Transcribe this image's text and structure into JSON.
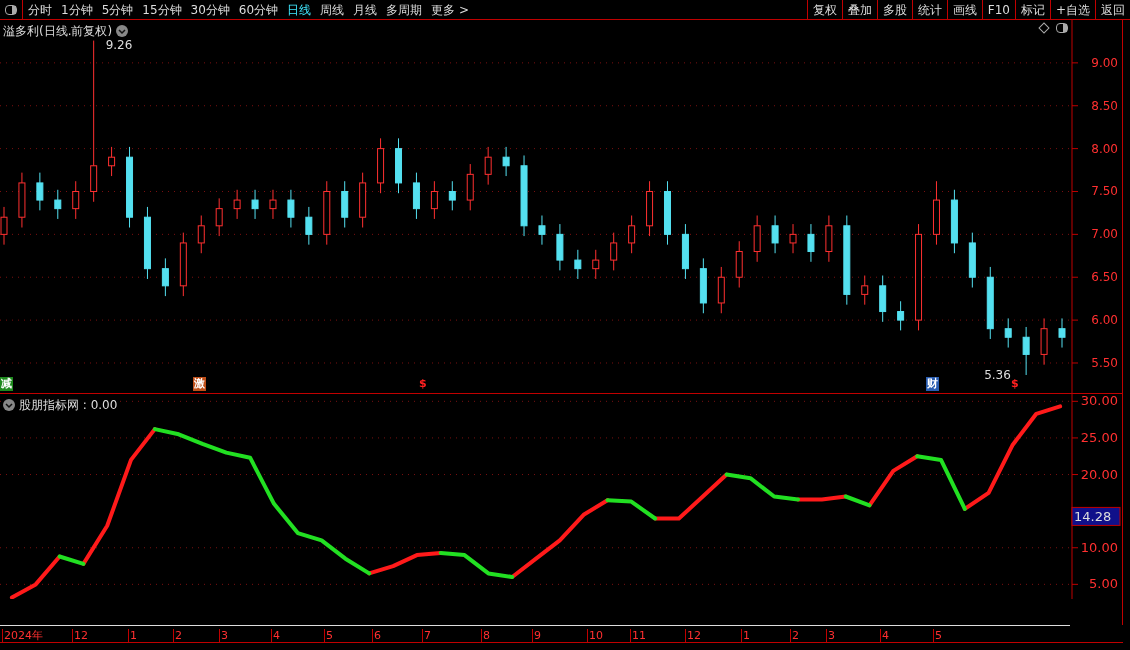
{
  "toolbar": {
    "periods": [
      {
        "label": "分时",
        "selected": false
      },
      {
        "label": "1分钟",
        "selected": false
      },
      {
        "label": "5分钟",
        "selected": false
      },
      {
        "label": "15分钟",
        "selected": false
      },
      {
        "label": "30分钟",
        "selected": false
      },
      {
        "label": "60分钟",
        "selected": false
      },
      {
        "label": "日线",
        "selected": true
      },
      {
        "label": "周线",
        "selected": false
      },
      {
        "label": "月线",
        "selected": false
      },
      {
        "label": "多周期",
        "selected": false
      },
      {
        "label": "更多 >",
        "selected": false
      }
    ],
    "actions": [
      "复权",
      "叠加",
      "多股",
      "统计",
      "画线",
      "F10",
      "标记",
      "+自选",
      "返回"
    ]
  },
  "price_panel": {
    "title": "溢多利(日线.前复权)",
    "high_label": "9.26",
    "low_label": "5.36",
    "markers": [
      {
        "kind": "tag",
        "text": "减",
        "color": "#1e8a1e"
      },
      {
        "kind": "tag",
        "text": "激",
        "color": "#c0501a"
      },
      {
        "kind": "dollar",
        "text": "$",
        "color": "#ff2020"
      },
      {
        "kind": "tag",
        "text": "财",
        "color": "#2a5db0"
      },
      {
        "kind": "dollar",
        "text": "$",
        "color": "#ff2020"
      }
    ],
    "chart_data": {
      "type": "candlestick",
      "grid": true,
      "ylim": [
        5.15,
        9.5
      ],
      "yticks": [
        {
          "value": 9,
          "label": "9.00"
        },
        {
          "value": 8.5,
          "label": "8.50"
        },
        {
          "value": 8,
          "label": "8.00"
        },
        {
          "value": 7.5,
          "label": "7.50"
        },
        {
          "value": 7,
          "label": "7.00"
        },
        {
          "value": 6.5,
          "label": "6.50"
        },
        {
          "value": 6,
          "label": "6.00"
        },
        {
          "value": 5.5,
          "label": "5.50"
        }
      ],
      "ohlc": [
        [
          7.0,
          7.32,
          6.88,
          7.2
        ],
        [
          7.2,
          7.72,
          7.08,
          7.6
        ],
        [
          7.6,
          7.72,
          7.28,
          7.4
        ],
        [
          7.4,
          7.52,
          7.18,
          7.3
        ],
        [
          7.3,
          7.62,
          7.18,
          7.5
        ],
        [
          7.5,
          9.26,
          7.38,
          7.8
        ],
        [
          7.8,
          8.02,
          7.68,
          7.9
        ],
        [
          7.9,
          8.02,
          7.08,
          7.2
        ],
        [
          7.2,
          7.32,
          6.48,
          6.6
        ],
        [
          6.6,
          6.72,
          6.28,
          6.4
        ],
        [
          6.4,
          7.02,
          6.28,
          6.9
        ],
        [
          6.9,
          7.22,
          6.78,
          7.1
        ],
        [
          7.1,
          7.42,
          6.98,
          7.3
        ],
        [
          7.3,
          7.52,
          7.18,
          7.4
        ],
        [
          7.4,
          7.52,
          7.18,
          7.3
        ],
        [
          7.3,
          7.52,
          7.18,
          7.4
        ],
        [
          7.4,
          7.52,
          7.08,
          7.2
        ],
        [
          7.2,
          7.32,
          6.88,
          7.0
        ],
        [
          7.0,
          7.62,
          6.88,
          7.5
        ],
        [
          7.5,
          7.62,
          7.08,
          7.2
        ],
        [
          7.2,
          7.72,
          7.08,
          7.6
        ],
        [
          7.6,
          8.12,
          7.48,
          8.0
        ],
        [
          8.0,
          8.12,
          7.48,
          7.6
        ],
        [
          7.6,
          7.72,
          7.18,
          7.3
        ],
        [
          7.3,
          7.62,
          7.18,
          7.5
        ],
        [
          7.5,
          7.62,
          7.28,
          7.4
        ],
        [
          7.4,
          7.82,
          7.28,
          7.7
        ],
        [
          7.7,
          8.02,
          7.58,
          7.9
        ],
        [
          7.9,
          8.02,
          7.68,
          7.8
        ],
        [
          7.8,
          7.92,
          6.98,
          7.1
        ],
        [
          7.1,
          7.22,
          6.88,
          7.0
        ],
        [
          7.0,
          7.12,
          6.58,
          6.7
        ],
        [
          6.7,
          6.82,
          6.48,
          6.6
        ],
        [
          6.6,
          6.82,
          6.48,
          6.7
        ],
        [
          6.7,
          7.02,
          6.58,
          6.9
        ],
        [
          6.9,
          7.22,
          6.78,
          7.1
        ],
        [
          7.1,
          7.62,
          6.98,
          7.5
        ],
        [
          7.5,
          7.62,
          6.88,
          7.0
        ],
        [
          7.0,
          7.12,
          6.48,
          6.6
        ],
        [
          6.6,
          6.72,
          6.08,
          6.2
        ],
        [
          6.2,
          6.62,
          6.08,
          6.5
        ],
        [
          6.5,
          6.92,
          6.38,
          6.8
        ],
        [
          6.8,
          7.22,
          6.68,
          7.1
        ],
        [
          7.1,
          7.22,
          6.78,
          6.9
        ],
        [
          6.9,
          7.12,
          6.78,
          7.0
        ],
        [
          7.0,
          7.12,
          6.68,
          6.8
        ],
        [
          6.8,
          7.22,
          6.68,
          7.1
        ],
        [
          7.1,
          7.22,
          6.18,
          6.3
        ],
        [
          6.3,
          6.52,
          6.18,
          6.4
        ],
        [
          6.4,
          6.52,
          5.98,
          6.1
        ],
        [
          6.1,
          6.22,
          5.88,
          6.0
        ],
        [
          6.0,
          7.12,
          5.88,
          7.0
        ],
        [
          7.0,
          7.62,
          6.88,
          7.4
        ],
        [
          7.4,
          7.52,
          6.78,
          6.9
        ],
        [
          6.9,
          7.02,
          6.38,
          6.5
        ],
        [
          6.5,
          6.62,
          5.78,
          5.9
        ],
        [
          5.9,
          6.02,
          5.68,
          5.8
        ],
        [
          5.8,
          5.92,
          5.36,
          5.6
        ],
        [
          5.6,
          6.02,
          5.48,
          5.9
        ],
        [
          5.9,
          6.02,
          5.68,
          5.8
        ]
      ]
    }
  },
  "indicator_panel": {
    "title": "股朋指标网 : 0.00",
    "current_value": "14.28",
    "chart_data": {
      "type": "line",
      "grid": true,
      "ylim": [
        3,
        31
      ],
      "yticks": [
        {
          "value": 30,
          "label": "30.00"
        },
        {
          "value": 25,
          "label": "25.00"
        },
        {
          "value": 20,
          "label": "20.00"
        },
        {
          "value": 10,
          "label": "10.00"
        },
        {
          "value": 5,
          "label": "5.00"
        }
      ],
      "series": [
        {
          "color": "#ff1a1a",
          "values": [
            3.2,
            5,
            8.8,
            null,
            null,
            null,
            null,
            null,
            null,
            null,
            null,
            null,
            null,
            null,
            null,
            null,
            null,
            null,
            null,
            null,
            null,
            null,
            null,
            null,
            null,
            null,
            null,
            null,
            null,
            null,
            null,
            null,
            null,
            null,
            null,
            null,
            null,
            null,
            null,
            null,
            null,
            null,
            null,
            null,
            null
          ]
        },
        {
          "color": "#ff1a1a",
          "values": [
            null,
            null,
            null,
            7.8,
            13,
            22,
            26.2,
            null,
            null,
            null,
            null,
            null,
            null,
            null,
            null,
            null,
            null,
            null,
            null,
            null,
            null,
            null,
            null,
            null,
            null,
            null,
            null,
            null,
            null,
            null,
            null,
            null,
            null,
            null,
            null,
            null,
            null,
            null,
            null,
            null,
            null,
            null,
            null,
            null,
            null
          ]
        },
        {
          "color": "#ff1a1a",
          "values": [
            null,
            null,
            null,
            null,
            null,
            null,
            null,
            null,
            null,
            null,
            null,
            null,
            null,
            null,
            null,
            6.5,
            7.5,
            9,
            9.3,
            null,
            null,
            null,
            null,
            null,
            null,
            null,
            null,
            null,
            null,
            null,
            null,
            null,
            null,
            null,
            null,
            null,
            null,
            null,
            null,
            null,
            null,
            null,
            null,
            null,
            null
          ]
        },
        {
          "color": "#ff1a1a",
          "values": [
            null,
            null,
            null,
            null,
            null,
            null,
            null,
            null,
            null,
            null,
            null,
            null,
            null,
            null,
            null,
            null,
            null,
            null,
            null,
            null,
            null,
            6,
            8.5,
            11,
            14.5,
            16.5,
            null,
            null,
            null,
            null,
            null,
            null,
            null,
            null,
            null,
            null,
            null,
            null,
            null,
            null,
            null,
            null,
            null,
            null,
            null
          ]
        },
        {
          "color": "#ff1a1a",
          "values": [
            null,
            null,
            null,
            null,
            null,
            null,
            null,
            null,
            null,
            null,
            null,
            null,
            null,
            null,
            null,
            null,
            null,
            null,
            null,
            null,
            null,
            null,
            null,
            null,
            null,
            null,
            null,
            14,
            14,
            17,
            20,
            null,
            null,
            null,
            null,
            null,
            null,
            null,
            null,
            null,
            null,
            null,
            null,
            null,
            null
          ]
        },
        {
          "color": "#ff1a1a",
          "values": [
            null,
            null,
            null,
            null,
            null,
            null,
            null,
            null,
            null,
            null,
            null,
            null,
            null,
            null,
            null,
            null,
            null,
            null,
            null,
            null,
            null,
            null,
            null,
            null,
            null,
            null,
            null,
            null,
            null,
            null,
            null,
            null,
            null,
            16.6,
            16.6,
            17,
            null,
            null,
            null,
            null,
            null,
            null,
            null,
            null,
            null
          ]
        },
        {
          "color": "#ff1a1a",
          "values": [
            null,
            null,
            null,
            null,
            null,
            null,
            null,
            null,
            null,
            null,
            null,
            null,
            null,
            null,
            null,
            null,
            null,
            null,
            null,
            null,
            null,
            null,
            null,
            null,
            null,
            null,
            null,
            null,
            null,
            null,
            null,
            null,
            null,
            null,
            null,
            null,
            15.8,
            20.5,
            22.5,
            null,
            null,
            null,
            null,
            null,
            null
          ]
        },
        {
          "color": "#ff1a1a",
          "values": [
            null,
            null,
            null,
            null,
            null,
            null,
            null,
            null,
            null,
            null,
            null,
            null,
            null,
            null,
            null,
            null,
            null,
            null,
            null,
            null,
            null,
            null,
            null,
            null,
            null,
            null,
            null,
            null,
            null,
            null,
            null,
            null,
            null,
            null,
            null,
            null,
            null,
            null,
            null,
            null,
            15.3,
            17.5,
            24,
            28.3,
            29.3
          ]
        },
        {
          "color": "#22e022",
          "values": [
            null,
            null,
            8.8,
            7.8,
            null,
            null,
            null,
            null,
            null,
            null,
            null,
            null,
            null,
            null,
            null,
            null,
            null,
            null,
            null,
            null,
            null,
            null,
            null,
            null,
            null,
            null,
            null,
            null,
            null,
            null,
            null,
            null,
            null,
            null,
            null,
            null,
            null,
            null,
            null,
            null,
            null,
            null,
            null,
            null,
            null
          ]
        },
        {
          "color": "#22e022",
          "values": [
            null,
            null,
            null,
            null,
            null,
            null,
            26.2,
            25.5,
            24.2,
            23,
            22.3,
            16,
            12,
            11,
            8.5,
            6.5,
            null,
            null,
            null,
            null,
            null,
            null,
            null,
            null,
            null,
            null,
            null,
            null,
            null,
            null,
            null,
            null,
            null,
            null,
            null,
            null,
            null,
            null,
            null,
            null,
            null,
            null,
            null,
            null,
            null
          ]
        },
        {
          "color": "#22e022",
          "values": [
            null,
            null,
            null,
            null,
            null,
            null,
            null,
            null,
            null,
            null,
            null,
            null,
            null,
            null,
            null,
            null,
            null,
            null,
            9.3,
            9,
            6.5,
            6,
            null,
            null,
            null,
            null,
            null,
            null,
            null,
            null,
            null,
            null,
            null,
            null,
            null,
            null,
            null,
            null,
            null,
            null,
            null,
            null,
            null,
            null,
            null
          ]
        },
        {
          "color": "#22e022",
          "values": [
            null,
            null,
            null,
            null,
            null,
            null,
            null,
            null,
            null,
            null,
            null,
            null,
            null,
            null,
            null,
            null,
            null,
            null,
            null,
            null,
            null,
            null,
            null,
            null,
            null,
            16.5,
            16.3,
            14,
            null,
            null,
            null,
            null,
            null,
            null,
            null,
            null,
            null,
            null,
            null,
            null,
            null,
            null,
            null,
            null,
            null
          ]
        },
        {
          "color": "#22e022",
          "values": [
            null,
            null,
            null,
            null,
            null,
            null,
            null,
            null,
            null,
            null,
            null,
            null,
            null,
            null,
            null,
            null,
            null,
            null,
            null,
            null,
            null,
            null,
            null,
            null,
            null,
            null,
            null,
            null,
            null,
            null,
            20,
            19.5,
            17,
            16.6,
            null,
            null,
            null,
            null,
            null,
            null,
            null,
            null,
            null,
            null,
            null
          ]
        },
        {
          "color": "#22e022",
          "values": [
            null,
            null,
            null,
            null,
            null,
            null,
            null,
            null,
            null,
            null,
            null,
            null,
            null,
            null,
            null,
            null,
            null,
            null,
            null,
            null,
            null,
            null,
            null,
            null,
            null,
            null,
            null,
            null,
            null,
            null,
            null,
            null,
            null,
            null,
            null,
            17,
            15.8,
            null,
            null,
            null,
            null,
            null,
            null,
            null,
            null
          ]
        },
        {
          "color": "#22e022",
          "values": [
            null,
            null,
            null,
            null,
            null,
            null,
            null,
            null,
            null,
            null,
            null,
            null,
            null,
            null,
            null,
            null,
            null,
            null,
            null,
            null,
            null,
            null,
            null,
            null,
            null,
            null,
            null,
            null,
            null,
            null,
            null,
            null,
            null,
            null,
            null,
            null,
            null,
            null,
            22.5,
            22,
            15.3,
            null,
            null,
            null,
            null
          ]
        }
      ]
    }
  },
  "date_axis": [
    "2024年",
    "12",
    "1",
    "2",
    "3",
    "4",
    "5",
    "6",
    "7",
    "8",
    "9",
    "10",
    "11",
    "12",
    "1",
    "2",
    "3",
    "4",
    "5"
  ]
}
